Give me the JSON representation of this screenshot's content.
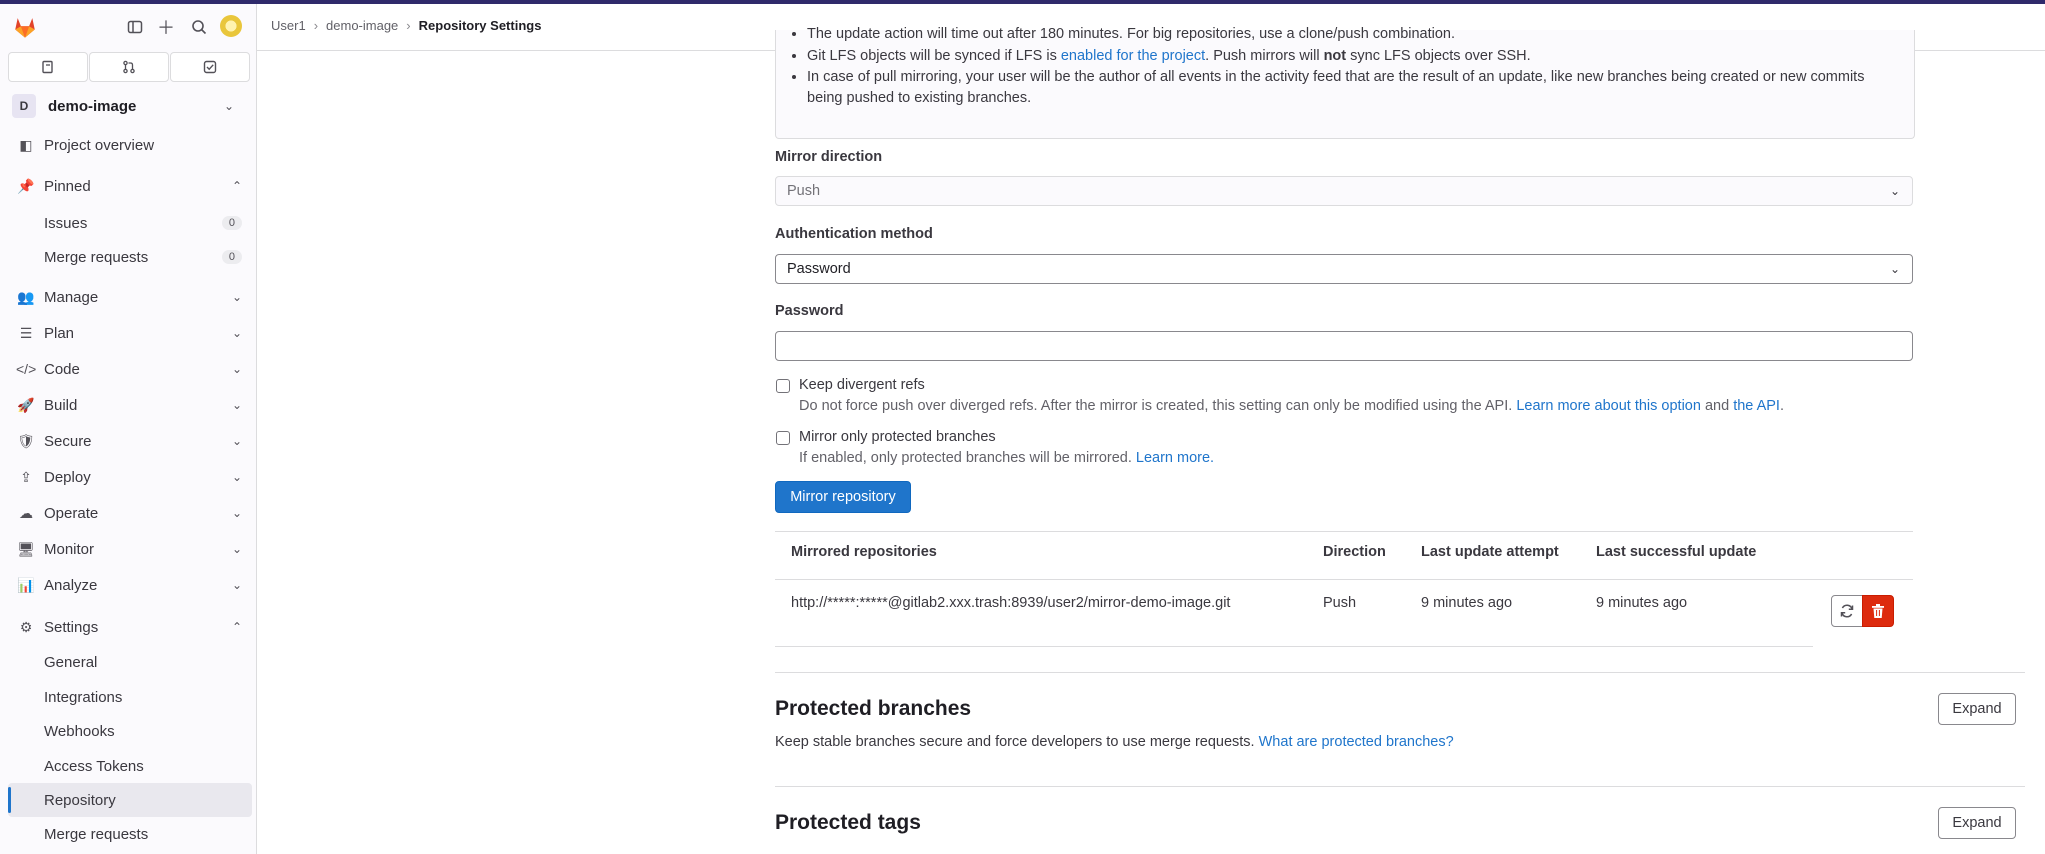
{
  "breadcrumb": {
    "items": [
      "User1",
      "demo-image"
    ],
    "current": "Repository Settings"
  },
  "sidebar": {
    "project_initial": "D",
    "project_name": "demo-image",
    "overview": "Project overview",
    "pinned": "Pinned",
    "pinned_items": [
      {
        "label": "Issues",
        "count": "0"
      },
      {
        "label": "Merge requests",
        "count": "0"
      }
    ],
    "sections": [
      "Manage",
      "Plan",
      "Code",
      "Build",
      "Secure",
      "Deploy",
      "Operate",
      "Monitor",
      "Analyze"
    ],
    "settings": "Settings",
    "settings_items": [
      "General",
      "Integrations",
      "Webhooks",
      "Access Tokens",
      "Repository",
      "Merge requests"
    ]
  },
  "notes": {
    "line1": "The update action will time out after 180 minutes. For big repositories, use a clone/push combination.",
    "line2_a": "Git LFS objects will be synced if LFS is ",
    "line2_link": "enabled for the project",
    "line2_b": ". Push mirrors will ",
    "line2_bold": "not",
    "line2_c": " sync LFS objects over SSH.",
    "line3": "In case of pull mirroring, your user will be the author of all events in the activity feed that are the result of an update, like new branches being created or new commits being pushed to existing branches."
  },
  "form": {
    "mirror_direction_label": "Mirror direction",
    "mirror_direction_value": "Push",
    "auth_label": "Authentication method",
    "auth_value": "Password",
    "password_label": "Password",
    "keep_divergent_label": "Keep divergent refs",
    "keep_divergent_help": "Do not force push over diverged refs. After the mirror is created, this setting can only be modified using the API.",
    "keep_divergent_link1": "Learn more about this option",
    "keep_divergent_and": "and",
    "keep_divergent_link2": "the API",
    "protected_only_label": "Mirror only protected branches",
    "protected_only_help": "If enabled, only protected branches will be mirrored.",
    "protected_only_link": "Learn more.",
    "submit": "Mirror repository"
  },
  "mirrors_table": {
    "headers": [
      "Mirrored repositories",
      "Direction",
      "Last update attempt",
      "Last successful update"
    ],
    "rows": [
      {
        "url": "http://*****:*****@gitlab2.xxx.trash:8939/user2/mirror-demo-image.git",
        "direction": "Push",
        "last_attempt": "9 minutes ago",
        "last_success": "9 minutes ago"
      }
    ]
  },
  "protected_branches": {
    "title": "Protected branches",
    "desc": "Keep stable branches secure and force developers to use merge requests.",
    "link": "What are protected branches?",
    "expand": "Expand"
  },
  "protected_tags": {
    "title": "Protected tags",
    "expand": "Expand"
  },
  "colors": {
    "accent": "#1f75cb",
    "danger": "#dd2b0e",
    "topbar": "#2f2a6b"
  }
}
